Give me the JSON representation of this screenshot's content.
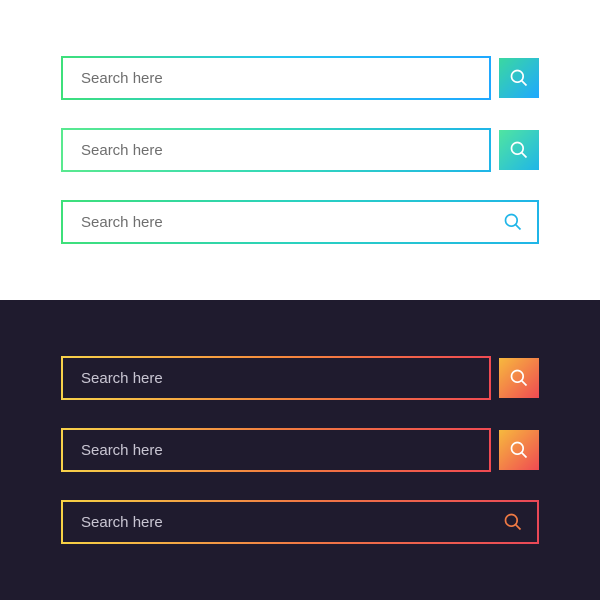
{
  "search": {
    "placeholder": "Search here"
  },
  "icons": {
    "search": "search-icon"
  },
  "colors": {
    "light_bg": "#ffffff",
    "dark_bg": "#1f1b2e",
    "grad_light_start": "#3ee07a",
    "grad_light_end": "#1fa8ff",
    "grad_dark_start": "#f7d24a",
    "grad_dark_end": "#ef4a52"
  }
}
